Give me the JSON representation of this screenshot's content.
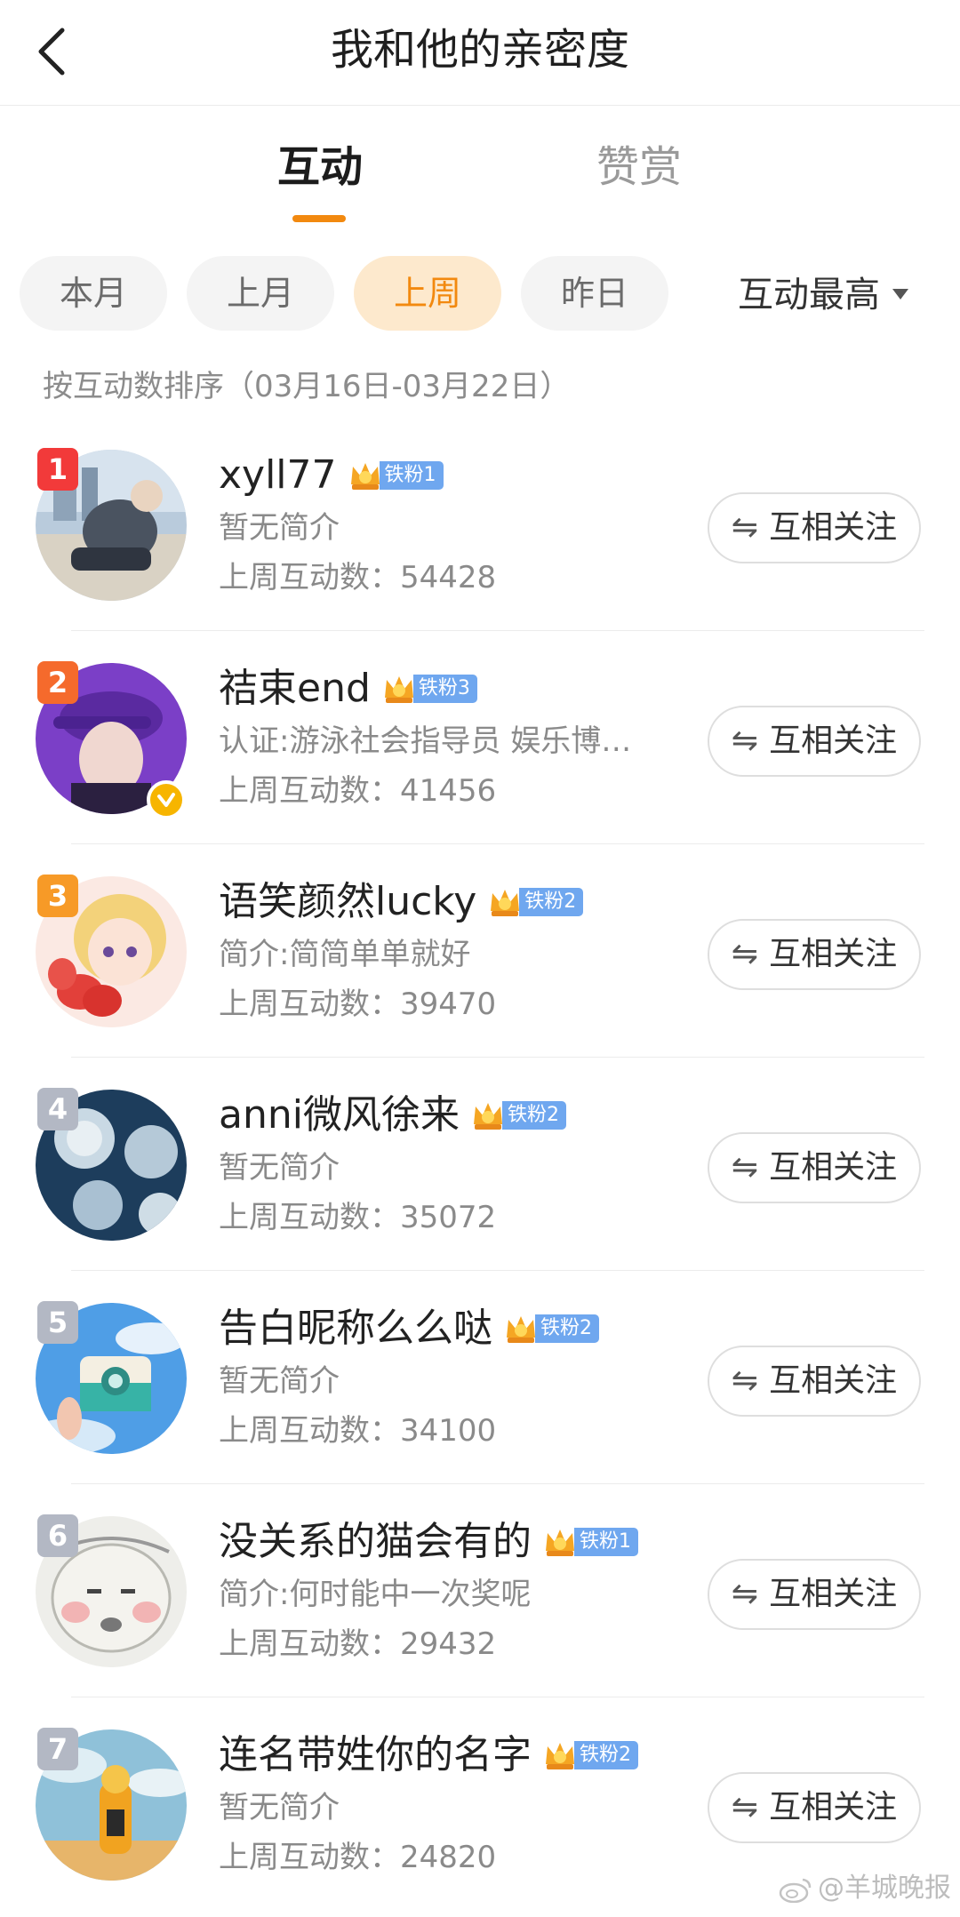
{
  "header": {
    "title": "我和他的亲密度"
  },
  "tabs": [
    {
      "label": "互动",
      "active": true
    },
    {
      "label": "赞赏",
      "active": false
    }
  ],
  "filters": [
    {
      "label": "本月",
      "active": false
    },
    {
      "label": "上月",
      "active": false
    },
    {
      "label": "上周",
      "active": true
    },
    {
      "label": "昨日",
      "active": false
    }
  ],
  "sort": {
    "label": "互动最高"
  },
  "sort_note": "按互动数排序（03月16日-03月22日）",
  "colors": {
    "accent": "#f2890f",
    "active_pill_bg": "#fde9cd",
    "fan_badge": "#6fa7ef",
    "rank_1": "#f23a3a",
    "rank_2": "#f56a2c",
    "rank_3": "#f79a27",
    "rank_other": "#b3b8c4"
  },
  "follow_label": "互相关注",
  "count_prefix": "上周互动数：",
  "users": [
    {
      "rank": "1",
      "name": "xyll77",
      "fan_level": "铁粉1",
      "bio": "暂无简介",
      "count": "54428",
      "verified": false
    },
    {
      "rank": "2",
      "name": "祮束end",
      "fan_level": "铁粉3",
      "bio": "认证:游泳社会指导员 娱乐博…",
      "count": "41456",
      "verified": true
    },
    {
      "rank": "3",
      "name": "语笑颜然lucky",
      "fan_level": "铁粉2",
      "bio": "简介:简简单单就好",
      "count": "39470",
      "verified": false
    },
    {
      "rank": "4",
      "name": "anni微风徐来",
      "fan_level": "铁粉2",
      "bio": "暂无简介",
      "count": "35072",
      "verified": false
    },
    {
      "rank": "5",
      "name": "告白昵称么么哒",
      "fan_level": "铁粉2",
      "bio": "暂无简介",
      "count": "34100",
      "verified": false
    },
    {
      "rank": "6",
      "name": "没关系的猫会有的",
      "fan_level": "铁粉1",
      "bio": "简介:何时能中一次奖呢",
      "count": "29432",
      "verified": false
    },
    {
      "rank": "7",
      "name": "连名带姓你的名字",
      "fan_level": "铁粉2",
      "bio": "暂无简介",
      "count": "24820",
      "verified": false
    }
  ],
  "watermark": "@羊城晚报"
}
